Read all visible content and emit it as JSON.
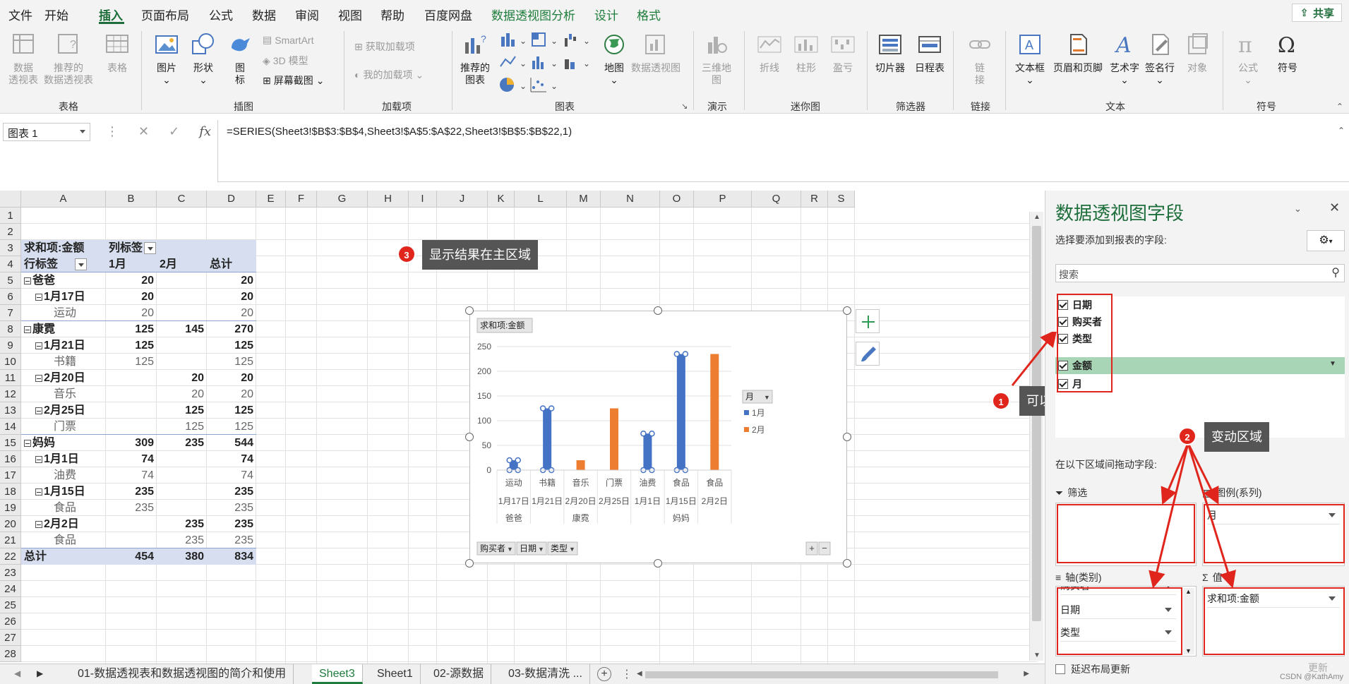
{
  "ribbon_tabs": [
    "文件",
    "开始",
    "插入",
    "页面布局",
    "公式",
    "数据",
    "审阅",
    "视图",
    "帮助",
    "百度网盘",
    "数据透视图分析",
    "设计",
    "格式"
  ],
  "share_label": "共享",
  "ribbon": {
    "groups": {
      "tables": "表格",
      "illustrations": "插图",
      "addins": "加载项",
      "charts": "图表",
      "tours": "演示",
      "sparklines": "迷你图",
      "filters": "筛选器",
      "links": "链接",
      "text": "文本",
      "symbols": "符号"
    },
    "buttons": {
      "pivot_table": "数据\n透视表",
      "recommended_pivot": "推荐的\n数据透视表",
      "table": "表格",
      "pictures": "图片",
      "shapes": "形状",
      "icons": "图\n标",
      "smartart": "SmartArt",
      "model3d": "3D 模型",
      "screenshot": "屏幕截图",
      "get_addins": "获取加载项",
      "my_addins": "我的加载项",
      "recommended_charts": "推荐的\n图表",
      "maps": "地图",
      "pivot_chart": "数据透视图",
      "map3d": "三维地\n图",
      "line": "折线",
      "column": "柱形",
      "winloss": "盈亏",
      "slicer": "切片器",
      "timeline": "日程表",
      "link": "链\n接",
      "textbox": "文本框",
      "header_footer": "页眉和页脚",
      "wordart": "艺术字",
      "signature": "签名行",
      "object": "对象",
      "equation": "公式",
      "symbol": "符号"
    }
  },
  "formula_bar": {
    "name_box": "图表 1",
    "formula": "=SERIES(Sheet3!$B$3:$B$4,Sheet3!$A$5:$A$22,Sheet3!$B$5:$B$22,1)"
  },
  "columns": [
    "A",
    "B",
    "C",
    "D",
    "E",
    "F",
    "G",
    "H",
    "I",
    "J",
    "K",
    "L",
    "M",
    "N",
    "O",
    "P",
    "Q",
    "R",
    "S"
  ],
  "rows": [
    "1",
    "2",
    "3",
    "4",
    "5",
    "6",
    "7",
    "8",
    "9",
    "10",
    "11",
    "12",
    "13",
    "14",
    "15",
    "16",
    "17",
    "18",
    "19",
    "20",
    "21",
    "22",
    "23",
    "24",
    "25",
    "26",
    "27",
    "28"
  ],
  "pivot": {
    "header1_a": "求和项:金额",
    "header1_b": "列标签",
    "header2_a": "行标签",
    "header2_b": "1月",
    "header2_c": "2月",
    "header2_d": "总计",
    "rows": [
      {
        "label": "爸爸",
        "b": "20",
        "c": "",
        "d": "20",
        "level": 0
      },
      {
        "label": "1月17日",
        "b": "20",
        "c": "",
        "d": "20",
        "level": 1
      },
      {
        "label": "运动",
        "b": "20",
        "c": "",
        "d": "20",
        "level": 2
      },
      {
        "label": "康霓",
        "b": "125",
        "c": "145",
        "d": "270",
        "level": 0
      },
      {
        "label": "1月21日",
        "b": "125",
        "c": "",
        "d": "125",
        "level": 1
      },
      {
        "label": "书籍",
        "b": "125",
        "c": "",
        "d": "125",
        "level": 2
      },
      {
        "label": "2月20日",
        "b": "",
        "c": "20",
        "d": "20",
        "level": 1
      },
      {
        "label": "音乐",
        "b": "",
        "c": "20",
        "d": "20",
        "level": 2
      },
      {
        "label": "2月25日",
        "b": "",
        "c": "125",
        "d": "125",
        "level": 1
      },
      {
        "label": "门票",
        "b": "",
        "c": "125",
        "d": "125",
        "level": 2
      },
      {
        "label": "妈妈",
        "b": "309",
        "c": "235",
        "d": "544",
        "level": 0
      },
      {
        "label": "1月1日",
        "b": "74",
        "c": "",
        "d": "74",
        "level": 1
      },
      {
        "label": "油费",
        "b": "74",
        "c": "",
        "d": "74",
        "level": 2
      },
      {
        "label": "1月15日",
        "b": "235",
        "c": "",
        "d": "235",
        "level": 1
      },
      {
        "label": "食品",
        "b": "235",
        "c": "",
        "d": "235",
        "level": 2
      },
      {
        "label": "2月2日",
        "b": "",
        "c": "235",
        "d": "235",
        "level": 1
      },
      {
        "label": "食品",
        "b": "",
        "c": "235",
        "d": "235",
        "level": 2
      }
    ],
    "total": {
      "label": "总计",
      "b": "454",
      "c": "380",
      "d": "834"
    }
  },
  "chart_data": {
    "type": "bar",
    "value_button": "求和项:金额",
    "categories": [
      "运动",
      "书籍",
      "音乐",
      "门票",
      "油费",
      "食品",
      "食品"
    ],
    "dates": [
      "1月17日",
      "1月21日",
      "2月20日",
      "2月25日",
      "1月1日",
      "1月15日",
      "2月2日"
    ],
    "buyers": [
      {
        "name": "爸爸",
        "span": 1
      },
      {
        "name": "康霓",
        "span": 3
      },
      {
        "name": "妈妈",
        "span": 3
      }
    ],
    "series": [
      {
        "name": "1月",
        "color": "#4472c4",
        "values": [
          20,
          125,
          null,
          null,
          74,
          235,
          null
        ]
      },
      {
        "name": "2月",
        "color": "#ed7d31",
        "values": [
          null,
          null,
          20,
          125,
          null,
          null,
          235
        ]
      }
    ],
    "yticks": [
      "0",
      "50",
      "100",
      "150",
      "200",
      "250"
    ],
    "ylim": [
      0,
      250
    ],
    "legend_title": "月",
    "legend_position": "right",
    "field_buttons": [
      "购买者",
      "日期",
      "类型"
    ],
    "zoom_buttons": [
      "+",
      "−"
    ]
  },
  "sheet_tabs": [
    "01-数据透视表和数据透视图的简介和使用",
    "Sheet3",
    "Sheet1",
    "02-源数据",
    "03-数据清洗 ..."
  ],
  "callouts": {
    "c1": {
      "num": "1",
      "text": "可以选择需要变动的数据"
    },
    "c2": {
      "num": "2",
      "text": "变动区域"
    },
    "c3": {
      "num": "3",
      "text": "显示结果在主区域"
    }
  },
  "pane": {
    "title": "数据透视图字段",
    "subtitle": "选择要添加到报表的字段:",
    "search_placeholder": "搜索",
    "fields": [
      "日期",
      "购买者",
      "类型",
      "金额",
      "月"
    ],
    "areas_hint": "在以下区域间拖动字段:",
    "filter_label": "筛选",
    "legend_label": "图例(系列)",
    "axis_label": "轴(类别)",
    "values_label": "值",
    "legend_items": [
      "月"
    ],
    "axis_items": [
      "购买者",
      "日期",
      "类型"
    ],
    "value_items": [
      "求和项:金额"
    ],
    "defer_label": "延迟布局更新",
    "update_label": "更新"
  },
  "watermark": "CSDN @KathAmy"
}
